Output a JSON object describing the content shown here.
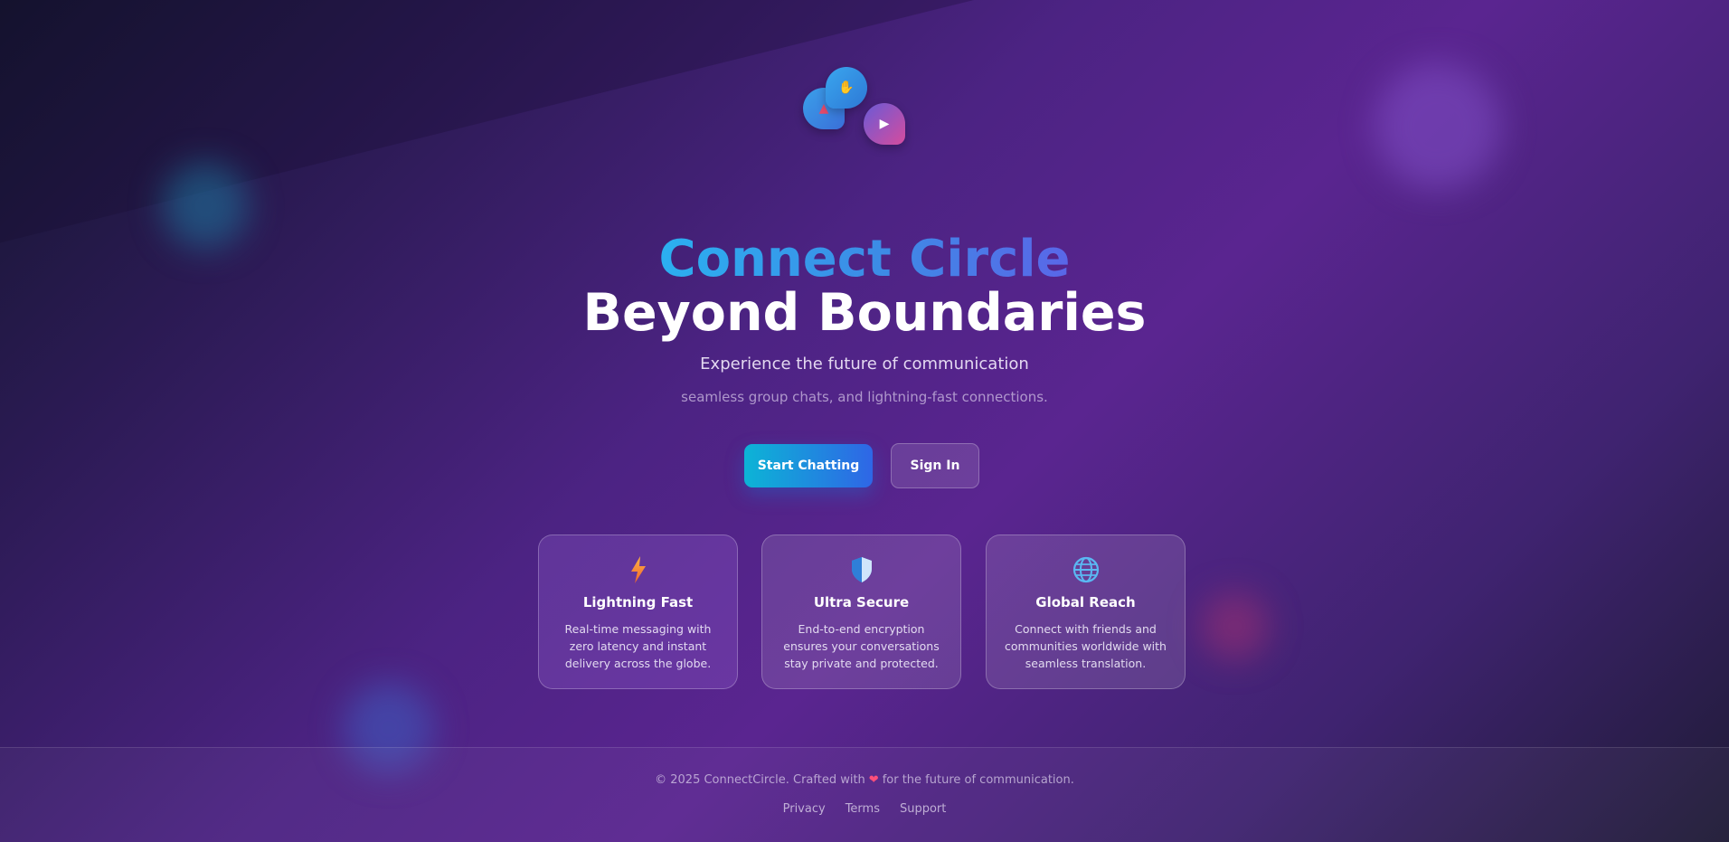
{
  "hero": {
    "title_top": "Connect Circle",
    "title_bottom": "Beyond Boundaries",
    "subtitle": "Experience the future of communication",
    "subtext": "seamless group chats, and lightning-fast connections."
  },
  "actions": {
    "primary_label": "Start Chatting",
    "secondary_label": "Sign In"
  },
  "features": [
    {
      "icon": "lightning-icon",
      "title": "Lightning Fast",
      "description": "Real-time messaging with zero latency and instant delivery across the globe."
    },
    {
      "icon": "shield-icon",
      "title": "Ultra Secure",
      "description": "End-to-end encryption ensures your conversations stay private and protected."
    },
    {
      "icon": "globe-icon",
      "title": "Global Reach",
      "description": "Connect with friends and communities worldwide with seamless translation."
    }
  ],
  "footer": {
    "copyright_prefix": "© 2025 ConnectCircle. Crafted with",
    "heart": "❤",
    "copyright_suffix": "for the future of communication.",
    "links": [
      "Privacy",
      "Terms",
      "Support"
    ]
  },
  "colors": {
    "accent_cyan": "#0cb4d6",
    "accent_blue": "#2f66e6",
    "background_purple": "#4c2383",
    "heart_pink": "#ff4f7a"
  }
}
